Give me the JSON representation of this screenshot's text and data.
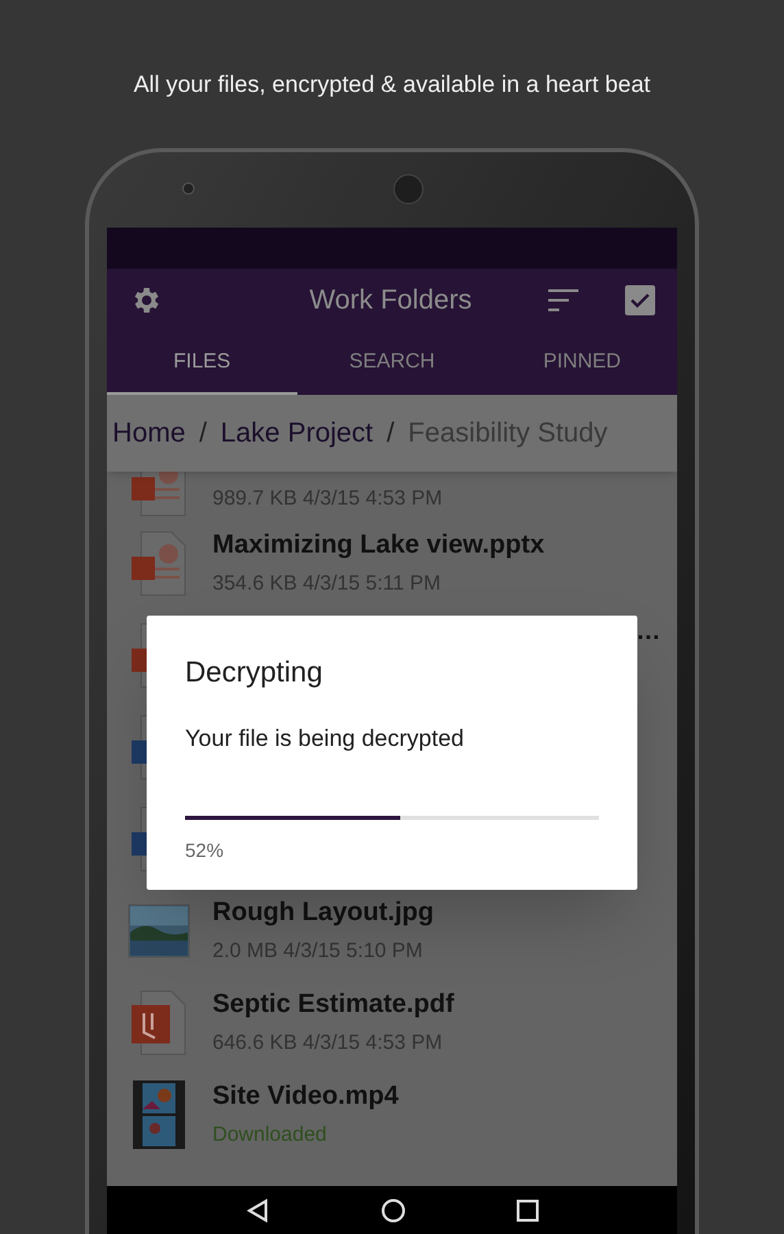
{
  "caption": "All your files, encrypted & available in a heart beat",
  "app_bar": {
    "title": "Work Folders"
  },
  "tabs": [
    {
      "label": "FILES",
      "selected": true
    },
    {
      "label": "SEARCH",
      "selected": false
    },
    {
      "label": "PINNED",
      "selected": false
    }
  ],
  "breadcrumb": [
    {
      "kind": "link",
      "label": "Home"
    },
    {
      "kind": "separator",
      "label": "/"
    },
    {
      "kind": "link",
      "label": "Lake Project"
    },
    {
      "kind": "separator",
      "label": "/"
    },
    {
      "kind": "current",
      "label": "Feasibility Study"
    }
  ],
  "files": [
    {
      "kind": "ppt",
      "detail": "989.7 KB  4/3/15 4:53 PM"
    },
    {
      "kind": "ppt",
      "name": "Maximizing Lake view.pptx",
      "detail": "354.6 KB  4/3/15 5:11 PM"
    },
    {
      "kind": "ppt",
      "trailing": "…"
    },
    {
      "kind": "word"
    },
    {
      "kind": "word"
    },
    {
      "name": "Rough Layout.jpg",
      "detail": "2.0 MB  4/3/15 5:10 PM"
    },
    {
      "kind": "pdf",
      "name": "Septic Estimate.pdf",
      "detail": "646.6 KB  4/3/15 4:53 PM"
    },
    {
      "kind": "video",
      "name": "Site Video.mp4",
      "status": "Downloaded"
    }
  ],
  "dialog": {
    "title": "Decrypting",
    "message": "Your file is being decrypted",
    "level": 0.52,
    "percent": "52%"
  }
}
